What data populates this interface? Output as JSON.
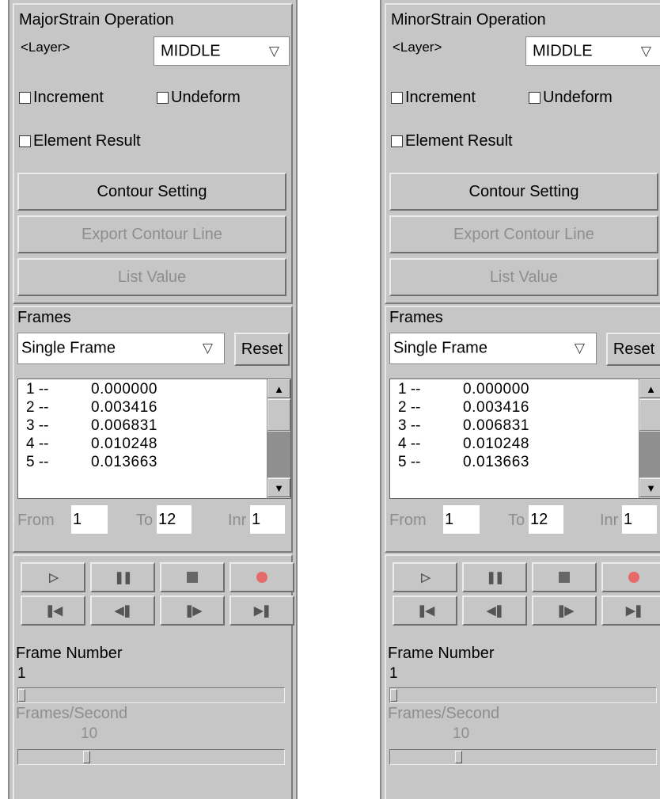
{
  "panels": [
    {
      "title": "MajorStrain Operation",
      "layer_label": "<Layer>",
      "layer_value": "MIDDLE",
      "checkboxes": {
        "increment": "Increment",
        "undeform": "Undeform",
        "element_result": "Element Result"
      },
      "buttons": {
        "contour_setting": "Contour Setting",
        "export_contour_line": "Export Contour Line",
        "list_value": "List Value"
      },
      "frames": {
        "title": "Frames",
        "mode": "Single Frame",
        "reset": "Reset",
        "rows": [
          {
            "idx": "1 --",
            "val": "0.000000"
          },
          {
            "idx": "2 --",
            "val": "0.003416"
          },
          {
            "idx": "3 --",
            "val": "0.006831"
          },
          {
            "idx": "4 --",
            "val": "0.010248"
          },
          {
            "idx": "5 --",
            "val": "0.013663"
          }
        ],
        "from_label": "From",
        "from_value": "1",
        "to_label": "To",
        "to_value": "12",
        "inr_label": "Inr",
        "inr_value": "1"
      },
      "player": {
        "frame_number_label": "Frame Number",
        "frame_number_value": "1",
        "frame_position": 0.0,
        "fps_label": "Frames/Second",
        "fps_value": "10",
        "fps_position": 0.25
      }
    },
    {
      "title": "MinorStrain Operation",
      "layer_label": "<Layer>",
      "layer_value": "MIDDLE",
      "checkboxes": {
        "increment": "Increment",
        "undeform": "Undeform",
        "element_result": "Element Result"
      },
      "buttons": {
        "contour_setting": "Contour Setting",
        "export_contour_line": "Export Contour Line",
        "list_value": "List Value"
      },
      "frames": {
        "title": "Frames",
        "mode": "Single Frame",
        "reset": "Reset",
        "rows": [
          {
            "idx": "1 --",
            "val": "0.000000"
          },
          {
            "idx": "2 --",
            "val": "0.003416"
          },
          {
            "idx": "3 --",
            "val": "0.006831"
          },
          {
            "idx": "4 --",
            "val": "0.010248"
          },
          {
            "idx": "5 --",
            "val": "0.013663"
          }
        ],
        "from_label": "From",
        "from_value": "1",
        "to_label": "To",
        "to_value": "12",
        "inr_label": "Inr",
        "inr_value": "1"
      },
      "player": {
        "frame_number_label": "Frame Number",
        "frame_number_value": "1",
        "frame_position": 0.0,
        "fps_label": "Frames/Second",
        "fps_value": "10",
        "fps_position": 0.25
      }
    }
  ]
}
